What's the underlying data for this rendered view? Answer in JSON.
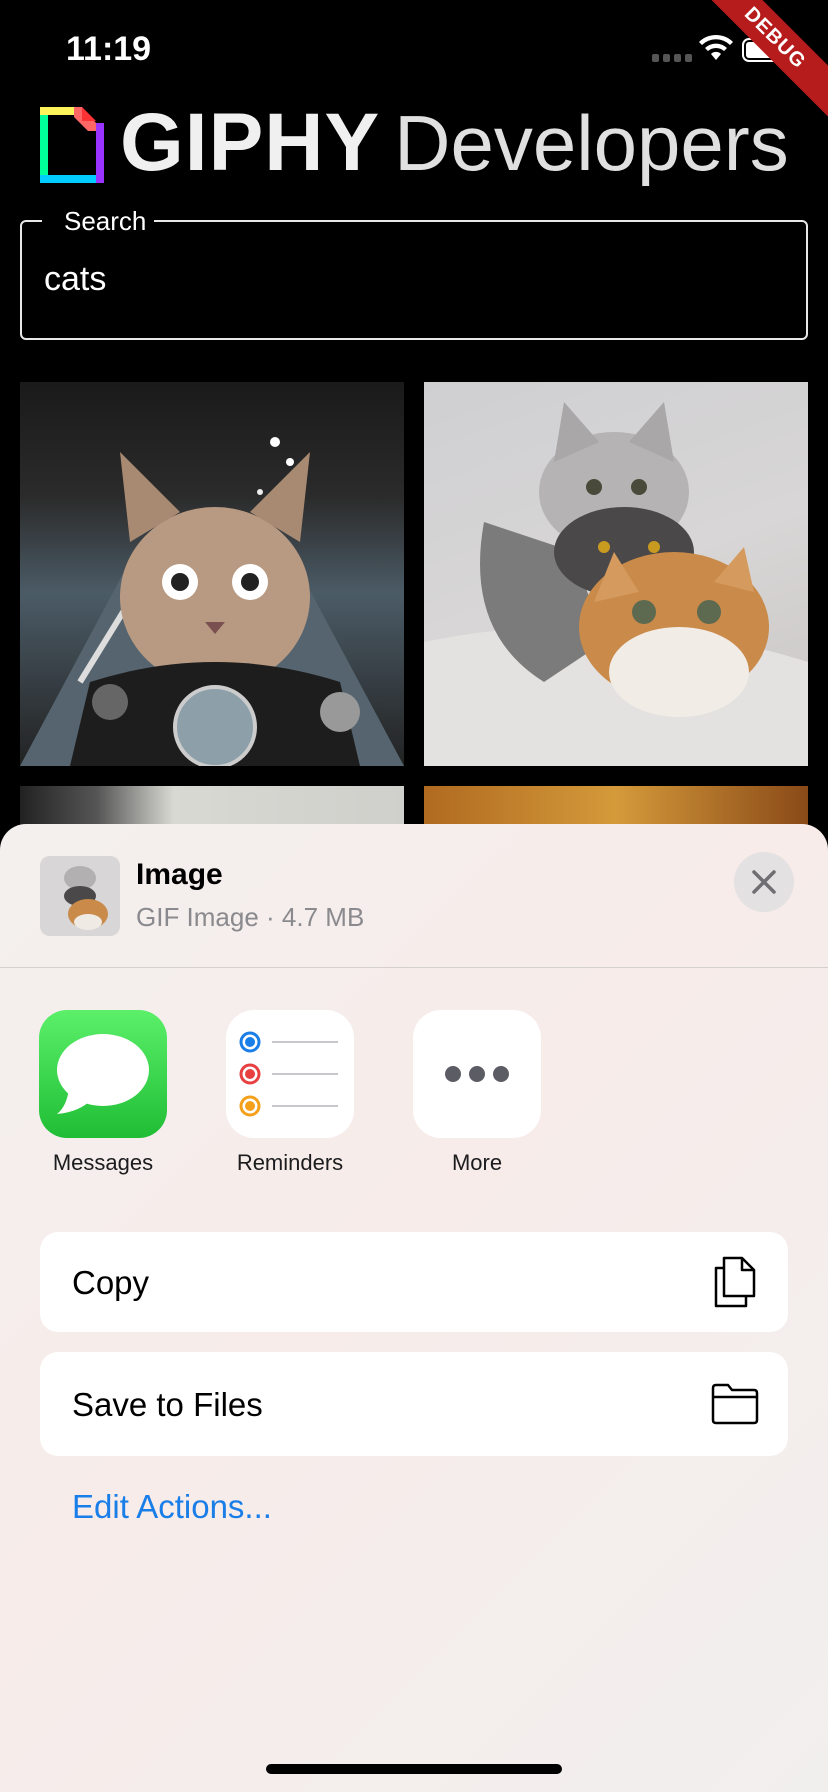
{
  "status_bar": {
    "time": "11:19",
    "debug_label": "DEBUG"
  },
  "header": {
    "logo_bold": "GIPHY",
    "logo_light": "Developers"
  },
  "search": {
    "label": "Search",
    "value": "cats"
  },
  "gifs": [
    {
      "name": "cat-riding-motorcycle"
    },
    {
      "name": "three-stacked-cats"
    },
    {
      "name": "partial-gif-3"
    },
    {
      "name": "partial-gif-4"
    }
  ],
  "share_sheet": {
    "title": "Image",
    "subtitle": "GIF Image · 4.7 MB",
    "apps": [
      {
        "label": "Messages",
        "icon": "messages-icon"
      },
      {
        "label": "Reminders",
        "icon": "reminders-icon"
      },
      {
        "label": "More",
        "icon": "more-icon"
      }
    ],
    "actions": [
      {
        "label": "Copy",
        "icon": "copy-icon"
      },
      {
        "label": "Save to Files",
        "icon": "folder-icon"
      }
    ],
    "edit_actions": "Edit Actions..."
  },
  "colors": {
    "accent_blue": "#1a7ee8",
    "messages_green": "#1fbd35",
    "debug_red": "#b71c1c"
  }
}
